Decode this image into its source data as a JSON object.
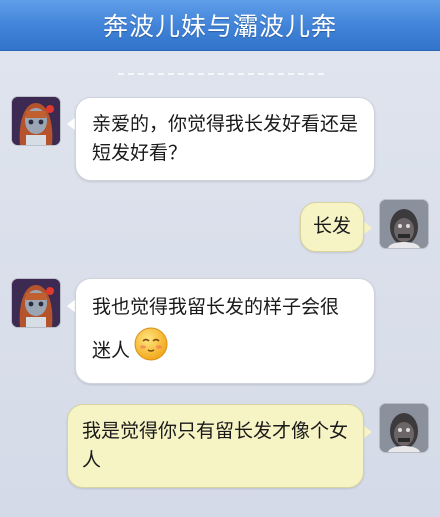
{
  "header": {
    "title": "奔波儿妹与灞波儿奔"
  },
  "messages": [
    {
      "sender": "girl",
      "text": "亲爱的，你觉得我长发好看还是短发好看？"
    },
    {
      "sender": "man",
      "text": "长发"
    },
    {
      "sender": "girl",
      "text_line1": "我也觉得我留长发的样子会很",
      "text_line2": "迷人",
      "emoji": "shy-smile-emoji"
    },
    {
      "sender": "man",
      "text": "我是觉得你只有留长发才像个女人"
    }
  ],
  "colors": {
    "header": "#3f82d8",
    "background": "#d9dfea",
    "bubble_incoming": "#ffffff",
    "bubble_outgoing": "#f6f3c5"
  }
}
